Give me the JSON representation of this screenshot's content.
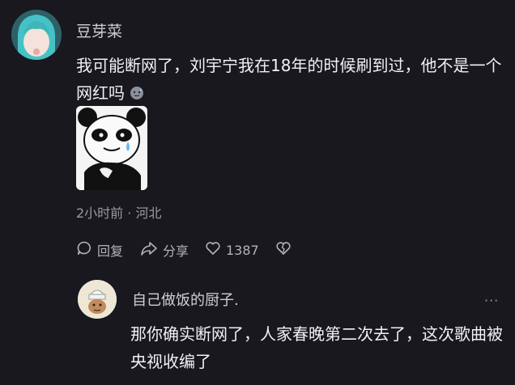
{
  "comment": {
    "username": "豆芽菜",
    "text": "我可能断网了，刘宇宁我在18年的时候刷到过，他不是一个网红吗",
    "meta": "2小时前 · 河北",
    "actions": {
      "reply_label": "回复",
      "share_label": "分享",
      "like_count": "1387"
    }
  },
  "reply": {
    "username": "自己做饭的厨子.",
    "more_label": "···",
    "text": "那你确实断网了，人家春晚第二次去了，这次歌曲被央视收编了"
  },
  "icons": {
    "reply": "comment-bubble-icon",
    "share": "share-arrow-icon",
    "like": "heart-icon",
    "dislike": "broken-heart-icon",
    "more": "more-dots-icon",
    "inline_emoji": "sweat-emoji-icon"
  },
  "colors": {
    "background": "#18181e",
    "text_primary": "#f1f1f3",
    "text_secondary": "#9a9ba1"
  }
}
